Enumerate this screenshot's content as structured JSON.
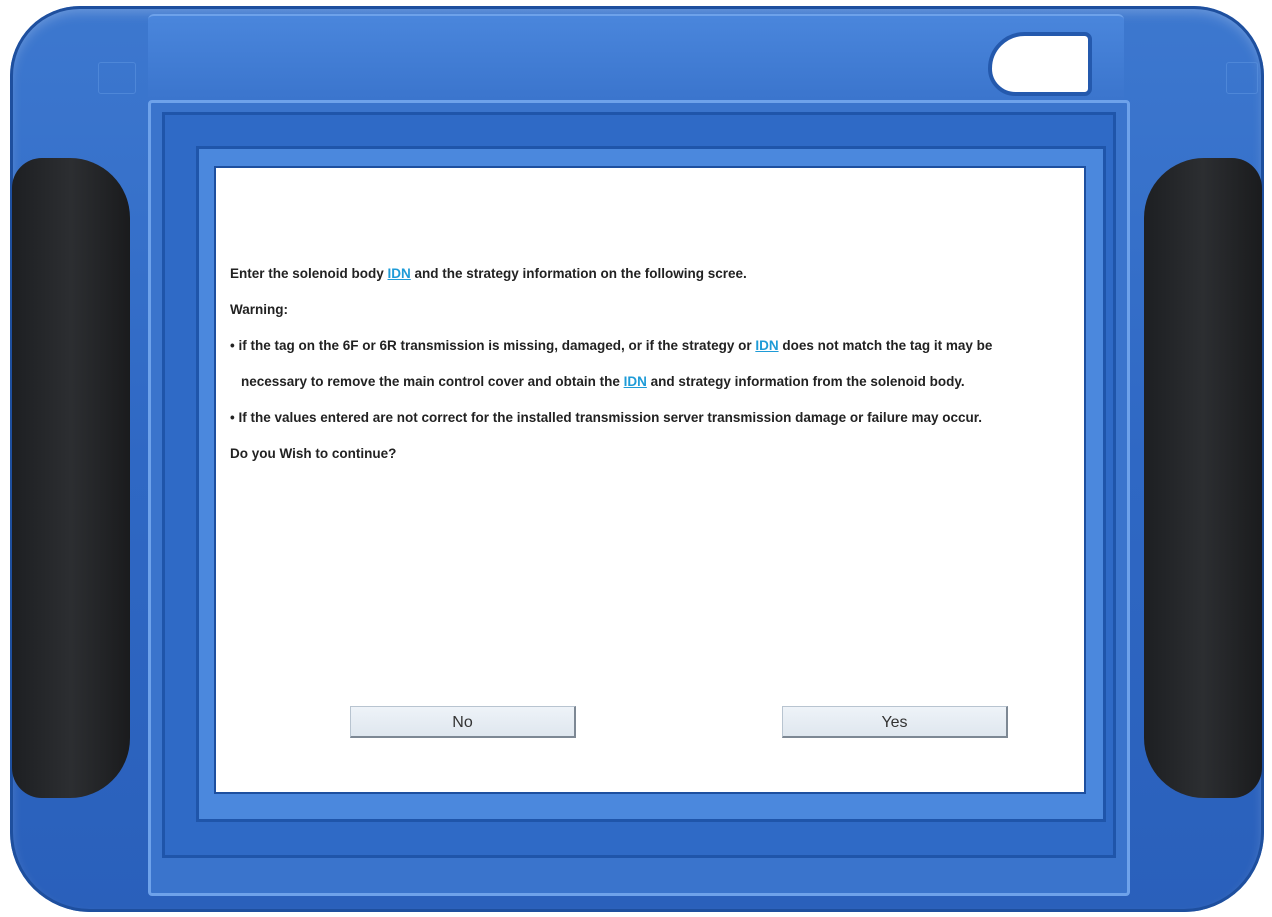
{
  "device": {
    "name": "diagnostic-tablet"
  },
  "dialog": {
    "line1_pre": "Enter the solenoid body ",
    "line1_link": "IDN",
    "line1_post": " and the strategy information on the following scree.",
    "warning_label": "Warning:",
    "bullet1_pre": "• if the tag on the 6F or 6R transmission is missing, damaged, or if the strategy or ",
    "bullet1_link": "IDN",
    "bullet1_post": " does not match the tag it may be",
    "bullet1_cont_pre": "necessary to remove the main control cover and obtain the ",
    "bullet1_cont_link": "IDN",
    "bullet1_cont_post": " and strategy information from the solenoid body.",
    "bullet2": "• If the values entered are not correct for the installed transmission server transmission damage or failure may occur.",
    "question": "Do you Wish to continue?",
    "no_label": "No",
    "yes_label": "Yes"
  },
  "colors": {
    "shell_blue": "#2f68c4",
    "grip_black": "#1d1f22",
    "link_blue": "#1e9bd7",
    "screen_bg": "#ffffff"
  }
}
